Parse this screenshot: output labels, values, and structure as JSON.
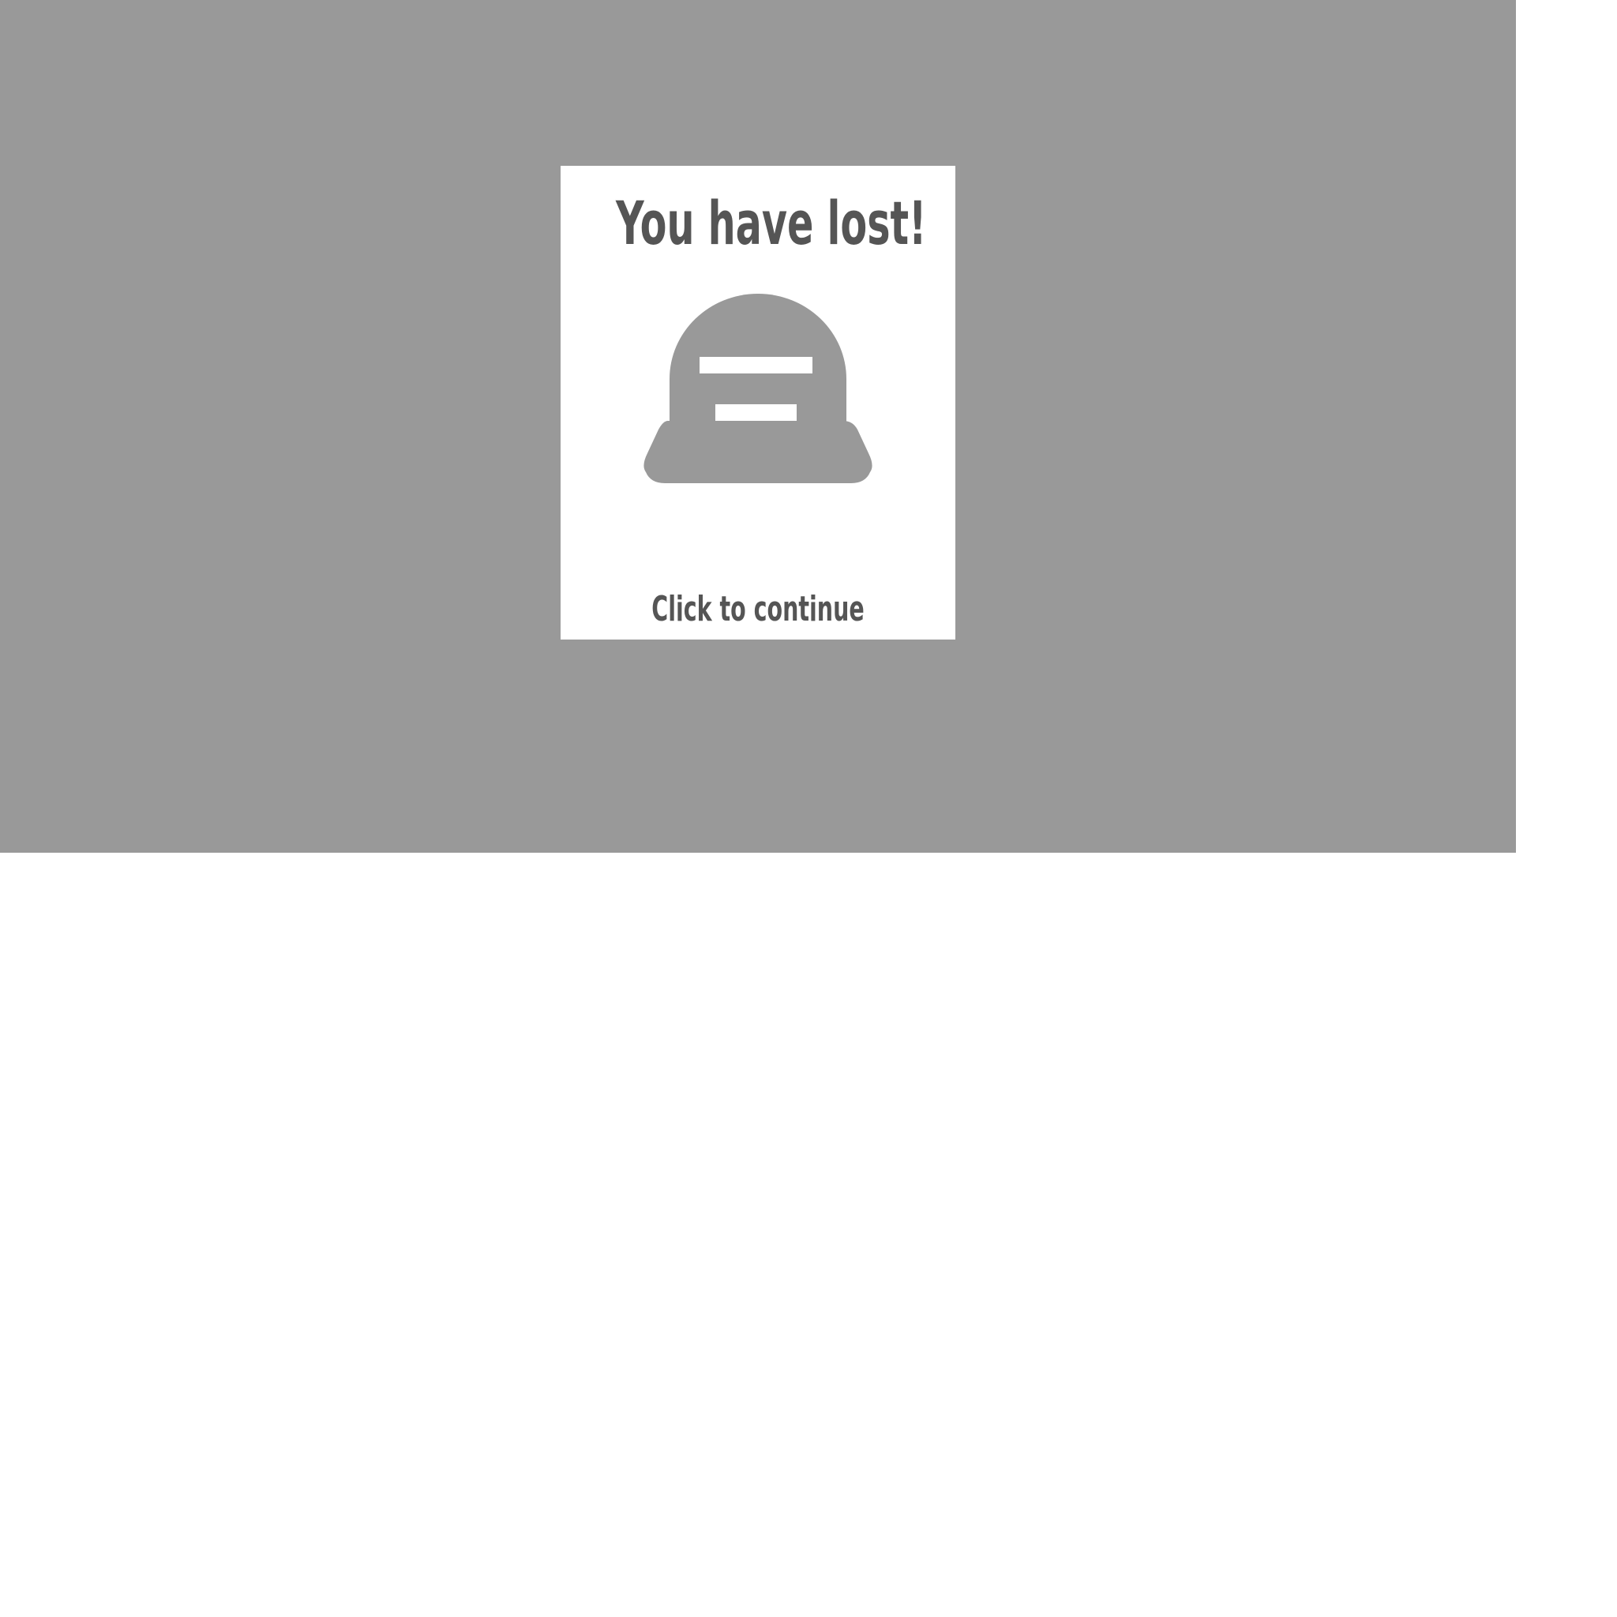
{
  "game": {
    "background_color": "#999999",
    "dialog_color": "#ffffff",
    "text_color": "#555555",
    "icon_color": "#999999"
  },
  "dialog": {
    "title": "You have lost!",
    "icon": "tombstone-icon",
    "prompt": "Click to continue"
  }
}
